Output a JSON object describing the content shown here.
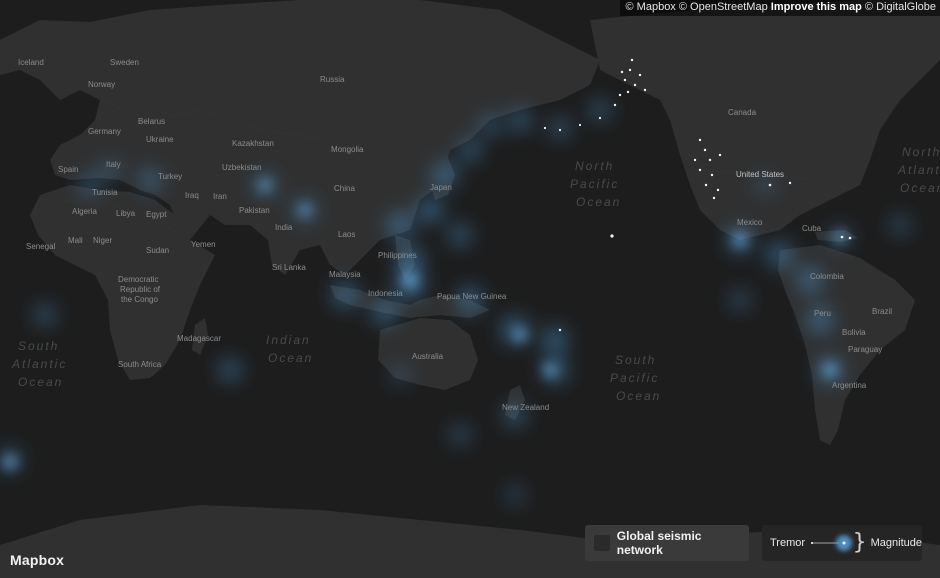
{
  "attribution": {
    "mapbox": "© Mapbox",
    "osm": "© OpenStreetMap",
    "improve": "Improve this map",
    "digitalglobe": "© DigitalGlobe"
  },
  "logo": "Mapbox",
  "legend": {
    "network_label": "Global seismic network",
    "tremor_label": "Tremor",
    "magnitude_label": "Magnitude"
  },
  "colors": {
    "land": "#303030",
    "ocean": "#1c1c1c",
    "glow": "#5aa9e6",
    "point": "#e8f4ff"
  },
  "places": {
    "iceland": "Iceland",
    "sweden": "Sweden",
    "norway": "Norway",
    "russia": "Russia",
    "belarus": "Belarus",
    "germany": "Germany",
    "ukraine": "Ukraine",
    "kazakhstan": "Kazakhstan",
    "mongolia": "Mongolia",
    "spain": "Spain",
    "italy": "Italy",
    "uzbekistan": "Uzbekistan",
    "tunisia": "Tunisia",
    "turkey": "Turkey",
    "china": "China",
    "algeria": "Algeria",
    "libya": "Libya",
    "egypt": "Egypt",
    "iraq": "Iraq",
    "iran": "Iran",
    "pakistan": "Pakistan",
    "india": "India",
    "japan": "Japan",
    "senegal": "Senegal",
    "mali": "Mali",
    "niger": "Niger",
    "sudan": "Sudan",
    "yemen": "Yemen",
    "laos": "Laos",
    "philippines": "Philippines",
    "srilanka": "Sri Lanka",
    "malaysia": "Malaysia",
    "indonesia": "Indonesia",
    "png": "Papua New Guinea",
    "drc1": "Democratic",
    "drc2": "Republic of",
    "drc3": "the Congo",
    "madagascar": "Madagascar",
    "southafrica": "South Africa",
    "australia": "Australia",
    "newzealand": "New Zealand",
    "canada": "Canada",
    "unitedstates": "United States",
    "mexico": "Mexico",
    "cuba": "Cuba",
    "colombia": "Colombia",
    "peru": "Peru",
    "brazil": "Brazil",
    "bolivia": "Bolivia",
    "paraguay": "Paraguay",
    "argentina": "Argentina"
  },
  "oceans": {
    "north_pacific": [
      "North",
      "Pacific",
      "Ocean"
    ],
    "south_pacific": [
      "South",
      "Pacific",
      "Ocean"
    ],
    "indian": [
      "Indian",
      "Ocean"
    ],
    "south_atlantic": [
      "South",
      "Atlantic",
      "Ocean"
    ],
    "north_atlantic": [
      "North",
      "Atlantic",
      "Ocean"
    ]
  }
}
